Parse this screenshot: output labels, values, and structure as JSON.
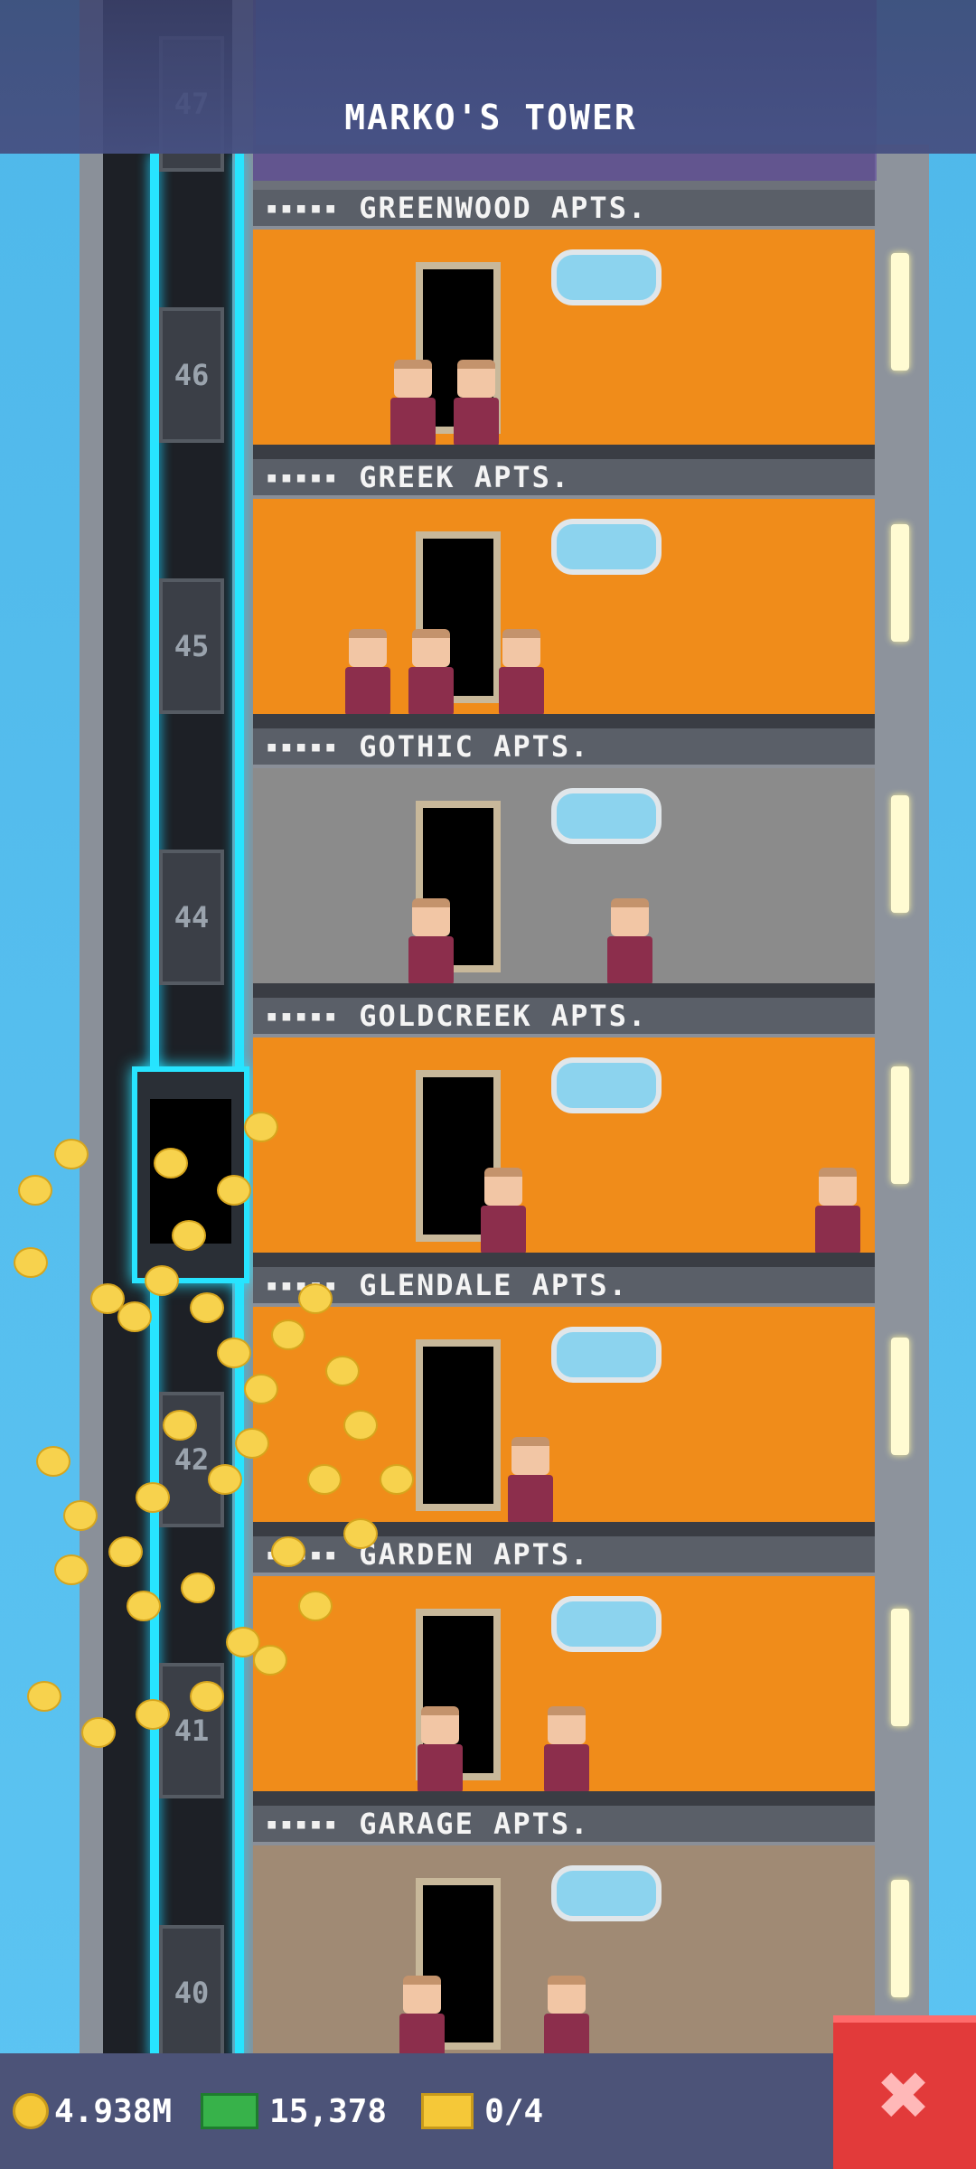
{
  "header": {
    "title": "MARKO'S TOWER"
  },
  "elevator": {
    "floor_numbers": [
      "47",
      "46",
      "45",
      "44",
      "42",
      "41",
      "40"
    ]
  },
  "floors": [
    {
      "rating": "▪▪▪▪▪",
      "name": "GREENWOOD APTS.",
      "wall": "#f08c1a"
    },
    {
      "rating": "▪▪▪▪▪",
      "name": "GREEK APTS.",
      "wall": "#f08c1a"
    },
    {
      "rating": "▪▪▪▪▪",
      "name": "GOTHIC APTS.",
      "wall": "#8b8b8b"
    },
    {
      "rating": "▪▪▪▪▪",
      "name": "GOLDCREEK APTS.",
      "wall": "#f08c1a"
    },
    {
      "rating": "▪▪▪▪▪",
      "name": "GLENDALE APTS.",
      "wall": "#f08c1a"
    },
    {
      "rating": "▪▪▪▪▪",
      "name": "GARDEN APTS.",
      "wall": "#f08c1a"
    },
    {
      "rating": "▪▪▪▪▪",
      "name": "GARAGE APTS.",
      "wall": "#a08a74"
    }
  ],
  "stats": {
    "coins": "4.938M",
    "bux": "15,378",
    "tickets": "0/4"
  },
  "icons": {
    "coin": "coin-icon",
    "bux": "bux-icon",
    "ticket": "ticket-icon",
    "close": "close-icon"
  }
}
